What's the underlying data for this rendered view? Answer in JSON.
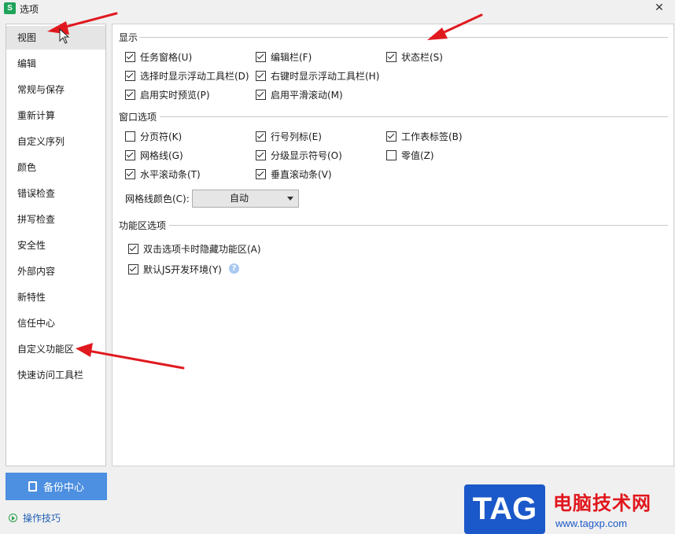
{
  "window": {
    "title": "选项",
    "app_icon": "S",
    "close": "✕"
  },
  "sidebar": {
    "items": [
      {
        "label": "视图",
        "active": true
      },
      {
        "label": "编辑"
      },
      {
        "label": "常规与保存"
      },
      {
        "label": "重新计算"
      },
      {
        "label": "自定义序列"
      },
      {
        "label": "颜色"
      },
      {
        "label": "错误检查"
      },
      {
        "label": "拼写检查"
      },
      {
        "label": "安全性"
      },
      {
        "label": "外部内容"
      },
      {
        "label": "新特性"
      },
      {
        "label": "信任中心"
      },
      {
        "label": "自定义功能区"
      },
      {
        "label": "快速访问工具栏"
      }
    ]
  },
  "display": {
    "heading": "显示",
    "options": [
      {
        "label": "任务窗格(U)",
        "checked": true
      },
      {
        "label": "编辑栏(F)",
        "checked": true
      },
      {
        "label": "状态栏(S)",
        "checked": true
      },
      {
        "label": "选择时显示浮动工具栏(D)",
        "checked": true
      },
      {
        "label": "右键时显示浮动工具栏(H)",
        "checked": true
      },
      {
        "label": "启用实时预览(P)",
        "checked": true
      },
      {
        "label": "启用平滑滚动(M)",
        "checked": true
      }
    ]
  },
  "window_options": {
    "heading": "窗口选项",
    "options": [
      {
        "label": "分页符(K)",
        "checked": false
      },
      {
        "label": "行号列标(E)",
        "checked": true
      },
      {
        "label": "工作表标签(B)",
        "checked": true
      },
      {
        "label": "网格线(G)",
        "checked": true
      },
      {
        "label": "分级显示符号(O)",
        "checked": true
      },
      {
        "label": "零值(Z)",
        "checked": false
      },
      {
        "label": "水平滚动条(T)",
        "checked": true
      },
      {
        "label": "垂直滚动条(V)",
        "checked": true
      }
    ],
    "gridline_color_label": "网格线颜色(C):",
    "gridline_color_value": "自动"
  },
  "ribbon": {
    "heading": "功能区选项",
    "options": [
      {
        "label": "双击选项卡时隐藏功能区(A)",
        "checked": true
      },
      {
        "label": "默认JS开发环境(Y)",
        "checked": true
      }
    ],
    "help": "?"
  },
  "footer": {
    "backup_label": "备份中心",
    "tips_label": "操作技巧"
  },
  "watermark": {
    "tag": "TAG",
    "site_name": "电脑技术网",
    "url": "www.tagxp.com"
  },
  "colors": {
    "accent": "#4d8fe0",
    "arrow": "#e0191f",
    "tag_blue": "#1b58c9"
  }
}
